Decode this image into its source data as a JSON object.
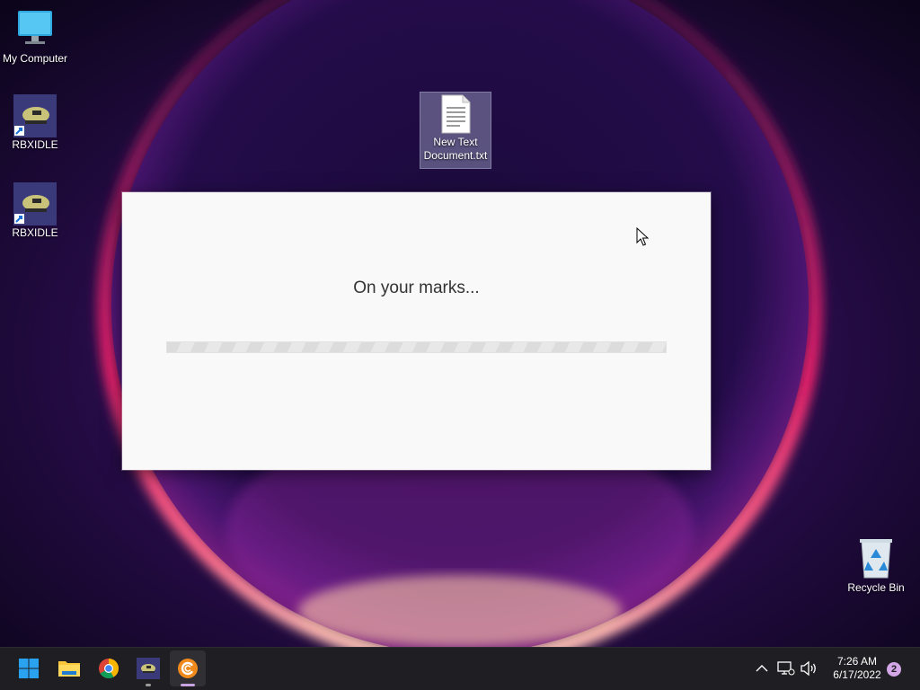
{
  "desktop": {
    "icons": [
      {
        "label": "My Computer",
        "icon": "computer-icon"
      },
      {
        "label": "RBXIDLE",
        "icon": "rbxidle-shortcut-icon"
      },
      {
        "label": "RBXIDLE",
        "icon": "rbxidle-shortcut-icon"
      },
      {
        "label": "New Text\nDocument.txt",
        "icon": "text-document-icon"
      },
      {
        "label": "Recycle Bin",
        "icon": "recycle-bin-icon"
      }
    ]
  },
  "dialog": {
    "status_text": "On your marks...",
    "progress": "indeterminate"
  },
  "taskbar": {
    "apps": [
      {
        "name": "Start",
        "icon": "windows-start-icon"
      },
      {
        "name": "File Explorer",
        "icon": "folder-icon"
      },
      {
        "name": "Google Chrome",
        "icon": "chrome-icon"
      },
      {
        "name": "RBXIDLE",
        "icon": "rbxidle-icon"
      },
      {
        "name": "CCleaner",
        "icon": "ccleaner-icon",
        "active": true
      }
    ],
    "tray": {
      "icons": [
        "chevron-up-icon",
        "network-icon",
        "volume-icon"
      ],
      "time": "7:26 AM",
      "date": "6/17/2022",
      "notification_count": "2"
    }
  },
  "colors": {
    "accent": "#0078d4",
    "active_indicator": "#c9a3e0",
    "dialog_bg": "#f9f9f9"
  }
}
